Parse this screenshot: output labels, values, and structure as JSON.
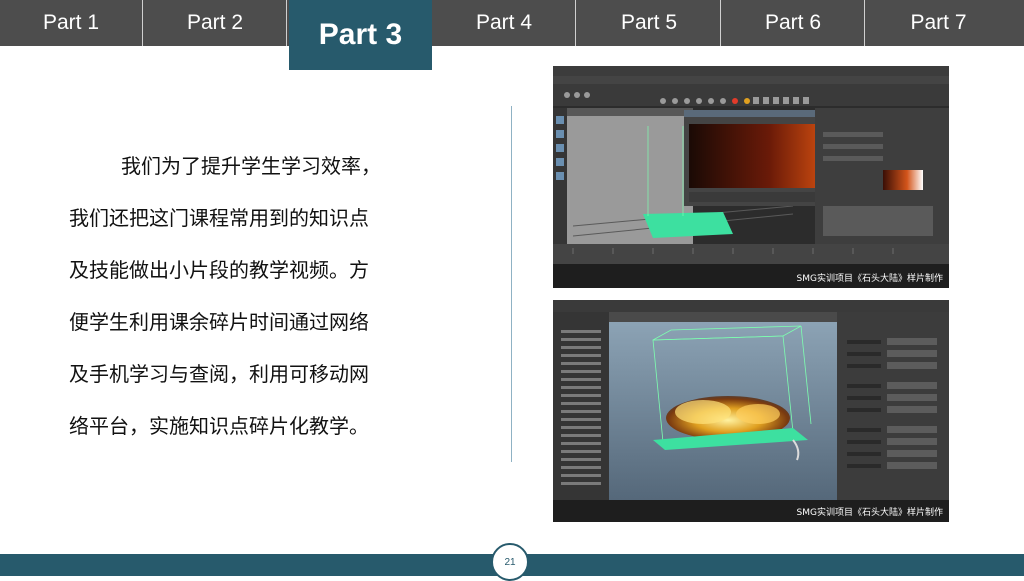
{
  "tabs": [
    {
      "label": "Part 1"
    },
    {
      "label": "Part 2"
    },
    {
      "label": "Part 3"
    },
    {
      "label": "Part 4"
    },
    {
      "label": "Part 5"
    },
    {
      "label": "Part 6"
    },
    {
      "label": "Part 7"
    }
  ],
  "active_tab": "Part 3",
  "paragraph": {
    "lines": [
      "我们为了提升学生学习效率，",
      "我们还把这门课程常用到的知识点",
      "及技能做出小片段的教学视频。方",
      "便学生利用课余碎片时间通过网络",
      "及手机学习与查阅，利用可移动网",
      "络平台，实施知识点碎片化教学。"
    ]
  },
  "screenshots": [
    {
      "caption": "SMG实训项目《石头大陆》样片制作"
    },
    {
      "caption": "SMG实训项目《石头大陆》样片制作"
    }
  ],
  "page_number": "21",
  "colors": {
    "tab_bar": "#4d4d4d",
    "accent": "#275a6c",
    "text": "#111111"
  }
}
